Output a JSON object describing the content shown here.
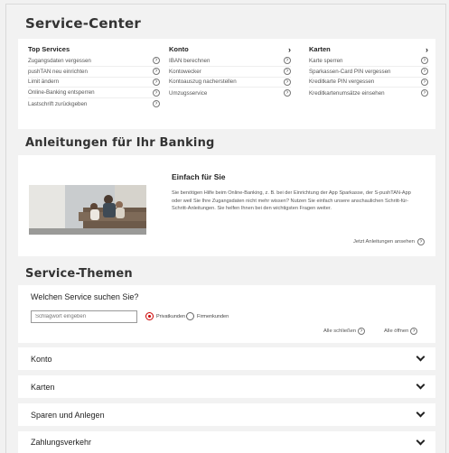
{
  "page": {
    "title": "Service-Center"
  },
  "top_services": {
    "title": "Top Services",
    "items": [
      "Zugangsdaten vergessen",
      "pushTAN neu einrichten",
      "Limit ändern",
      "Online-Banking entsperren",
      "Lastschrift zurückgeben"
    ]
  },
  "konto": {
    "title": "Konto",
    "items": [
      "IBAN berechnen",
      "Kontowecker",
      "Kontoauszug nacherstellen",
      "Umzugsservice"
    ]
  },
  "karten": {
    "title": "Karten",
    "items": [
      "Karte sperren",
      "Sparkassen-Card PIN vergessen",
      "Kreditkarte PIN vergessen",
      "Kreditkartenumsätze einsehen"
    ]
  },
  "anleitungen": {
    "title": "Anleitungen für Ihr Banking",
    "card_title": "Einfach für Sie",
    "text": "Sie benötigen Hilfe beim Online-Banking, z. B. bei der Einrichtung der App Sparkasse, der S-pushTAN-App oder weil Sie Ihre Zugangsdaten nicht mehr wissen? Nutzen Sie einfach unsere anschaulichen Schritt-für-Schritt-Anleitungen. Sie helfen Ihnen bei den wichtigsten Fragen weiter.",
    "link": "Jetzt Anleitungen ansehen"
  },
  "service_themen": {
    "title": "Service-Themen",
    "question": "Welchen Service suchen Sie?",
    "search_placeholder": "Schlagwort eingeben",
    "radio_private": "Privatkunden",
    "radio_business": "Firmenkunden",
    "collapse_all": "Alle schließen",
    "expand_all": "Alle öffnen",
    "accordion": [
      "Konto",
      "Karten",
      "Sparen und Anlegen",
      "Zahlungsverkehr"
    ]
  },
  "colors": {
    "accent": "#cc0000",
    "background": "#f2f2f2",
    "card": "#ffffff"
  }
}
